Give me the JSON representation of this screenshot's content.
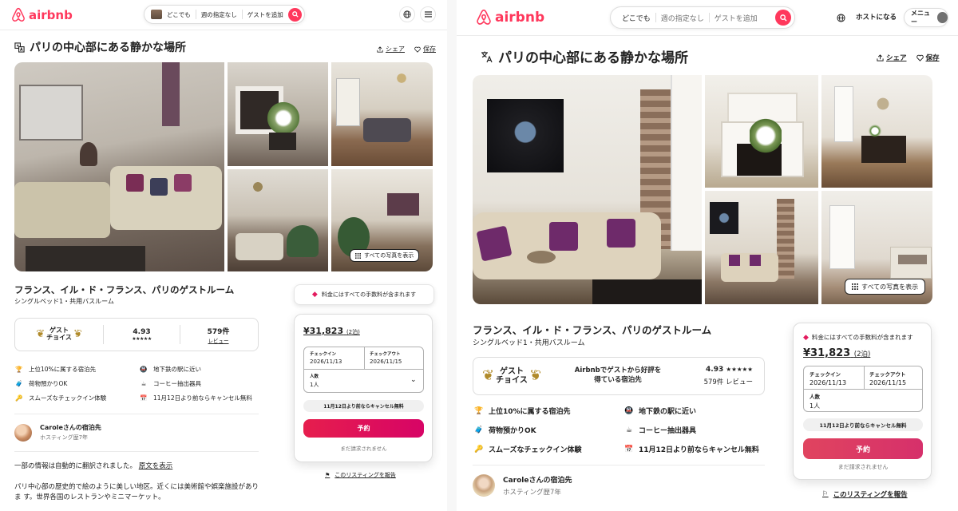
{
  "brand": {
    "name": "airbnb",
    "color": "#ff385c"
  },
  "search": {
    "where": "どこでも",
    "week": "週の指定なし",
    "guests": "ゲストを追加"
  },
  "header_right": {
    "host_label": "ホストになる",
    "menu_label": "メニュー"
  },
  "listing": {
    "title": "パリの中心部にある静かな場所",
    "share": "シェア",
    "save": "保存",
    "show_all_photos": "すべての写真を表示",
    "subtitle": "フランス、イル・ド・フランス、パリのゲストルーム",
    "room_info": "シングルベッド1・共用バスルーム"
  },
  "badge": {
    "title_line1": "ゲスト",
    "title_line2": "チョイス",
    "description": "Airbnbでゲストから好評を得ている宿泊先",
    "rating": "4.93",
    "stars": "★★★★★",
    "reviews_count": "579件",
    "reviews_label": "レビュー",
    "reviews_combined": "579件 レビュー"
  },
  "features": [
    {
      "icon": "trophy-icon",
      "text": "上位10%に属する宿泊先"
    },
    {
      "icon": "train-icon",
      "text": "地下鉄の駅に近い"
    },
    {
      "icon": "luggage-icon",
      "text": "荷物預かりOK"
    },
    {
      "icon": "coffee-icon",
      "text": "コーヒー抽出器具"
    },
    {
      "icon": "key-icon",
      "text": "スムーズなチェックイン体験"
    },
    {
      "icon": "calendar-icon",
      "text": "11月12日より前ならキャンセル無料"
    }
  ],
  "host": {
    "name": "Caroleさんの宿泊先",
    "since": "ホスティング歴7年"
  },
  "translation": {
    "notice": "一部の情報は自動的に翻訳されました。",
    "show_original": "原文を表示"
  },
  "description": "パリ中心部の歴史的で絵のように美しい地区。近くには美術館や娯楽施設がありま す。世界各国のレストランやミニマーケット。",
  "booking": {
    "fee_notice": "料金にはすべての手数料が含まれます",
    "price": "¥31,823",
    "nights": "(2泊)",
    "checkin_label": "チェックイン",
    "checkin_value": "2026/11/13",
    "checkout_label": "チェックアウト",
    "checkout_value": "2026/11/15",
    "guests_label": "人数",
    "guests_value": "1人",
    "cancel_note": "11月12日より前ならキャンセル無料",
    "reserve": "予約",
    "no_charge": "まだ請求されません",
    "report": "このリスティングを報告"
  },
  "colors": {
    "accent": "#ff385c",
    "reserve_start": "#e61e4d",
    "reserve_end": "#d70466",
    "text": "#222222",
    "muted": "#717171"
  }
}
